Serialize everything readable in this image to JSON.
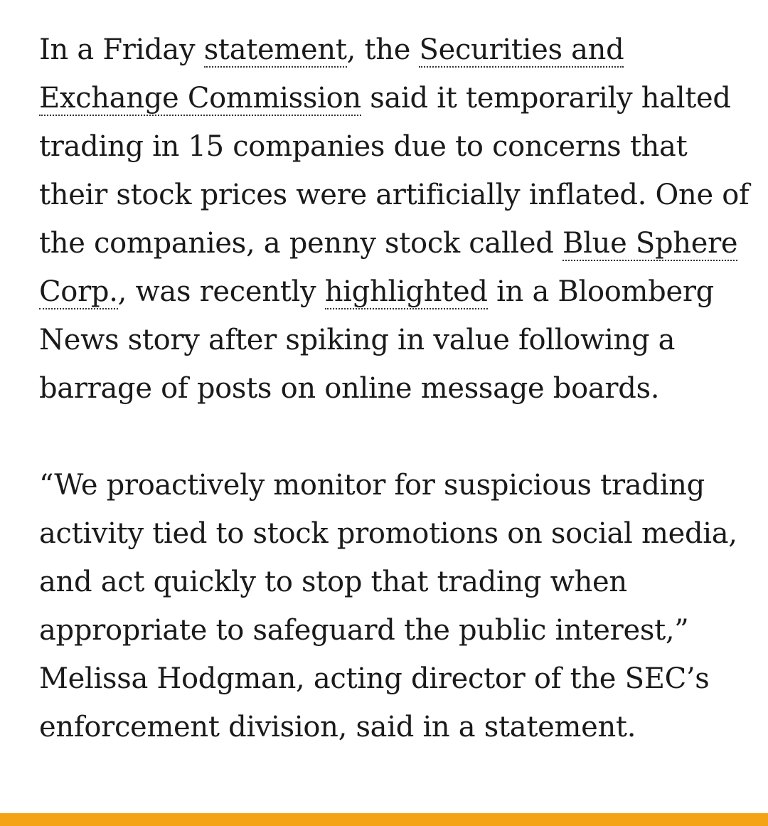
{
  "article": {
    "p1": {
      "t1": "In a Friday ",
      "link_statement": "statement",
      "t2": ", the ",
      "link_sec": "Securities and Exchange Commission",
      "t3": " said it temporarily halted trading in 15 companies due to concerns that their stock prices were artificially inflated. One of the companies, a penny stock called ",
      "link_blue_sphere": "Blue Sphere Corp.",
      "t4": ", was recently ",
      "link_highlighted": "highlighted",
      "t5": " in a Bloomberg News story after spiking in value following a barrage of posts on online message boards."
    },
    "p2": "“We proactively monitor for suspicious trading activity tied to stock promotions on social media, and act quickly to stop that trading when appropriate to safeguard the public interest,” Melissa Hodgman, acting director of the SEC’s enforcement division, said in a statement."
  },
  "colors": {
    "text": "#1a1a1a",
    "accent_bar": "#f5a316"
  }
}
